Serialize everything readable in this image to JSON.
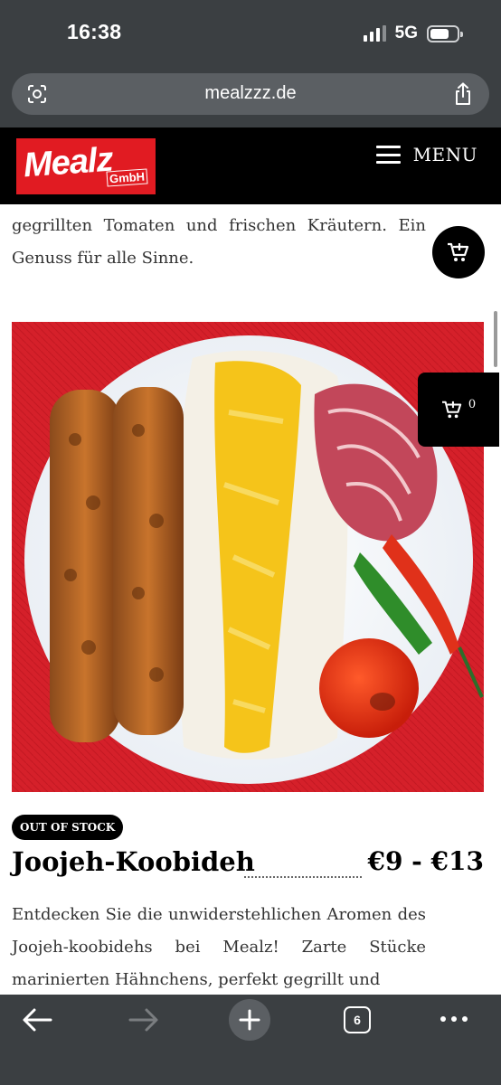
{
  "status_bar": {
    "time": "16:38",
    "network": "5G"
  },
  "browser": {
    "url": "mealzzz.de",
    "tab_count": "6"
  },
  "header": {
    "logo_main": "Mealz",
    "logo_sub": "GmbH",
    "menu_label": "MENU"
  },
  "content": {
    "top_paragraph": "gegrillten Tomaten und frischen Kräutern. Ein Genuss für alle Sinne.",
    "cart_count": "0",
    "product": {
      "badge": "OUT OF STOCK",
      "title": "Joojeh-Koobideh",
      "price": "€9 - €13",
      "description": "Entdecken Sie die unwiderstehlichen Aromen des Joojeh-koobidehs bei Mealz! Zarte Stücke marinierten Hähnchens, perfekt gegrillt und"
    }
  },
  "colors": {
    "brand_red": "#e11b22",
    "chrome": "#3b3f42",
    "header_bg": "#000000"
  },
  "icons": [
    "lens-icon",
    "share-icon",
    "cart-icon",
    "back-icon",
    "forward-icon",
    "new-tab-icon",
    "tabs-icon",
    "more-icon",
    "hamburger-icon"
  ]
}
